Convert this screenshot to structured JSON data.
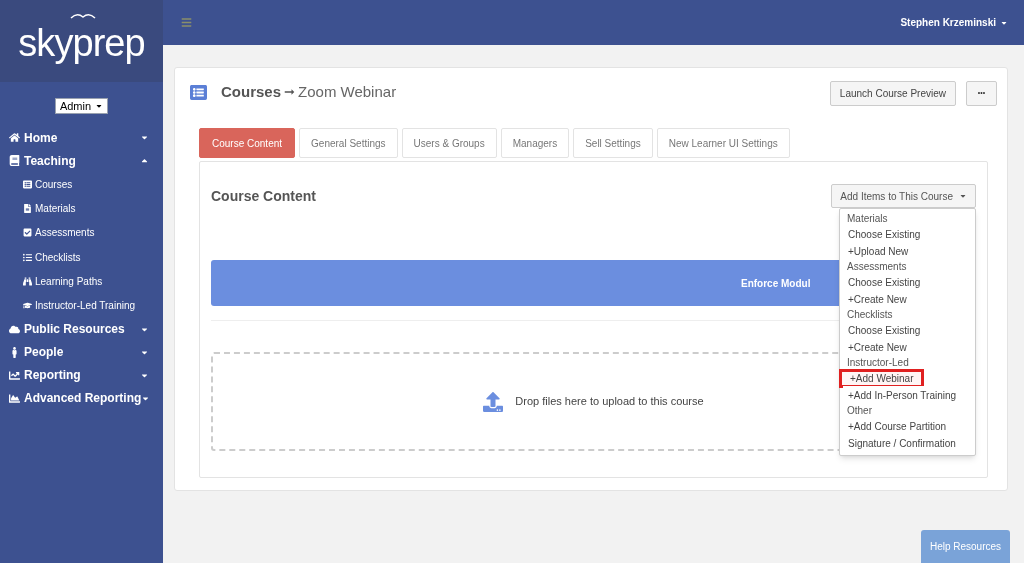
{
  "sidebar": {
    "logo": "skyprep",
    "role_select": "Admin",
    "items": [
      {
        "label": "Home",
        "expanded": false
      },
      {
        "label": "Teaching",
        "expanded": true,
        "children": [
          {
            "label": "Courses"
          },
          {
            "label": "Materials"
          },
          {
            "label": "Assessments"
          },
          {
            "label": "Checklists"
          },
          {
            "label": "Learning Paths"
          },
          {
            "label": "Instructor-Led Training"
          }
        ]
      },
      {
        "label": "Public Resources",
        "expanded": false
      },
      {
        "label": "People",
        "expanded": false
      },
      {
        "label": "Reporting",
        "expanded": false
      },
      {
        "label": "Advanced Reporting",
        "expanded": false
      }
    ]
  },
  "topbar": {
    "user": "Stephen Krzeminski"
  },
  "page": {
    "breadcrumb": "Courses",
    "arrow": "➞",
    "title": "Zoom Webinar",
    "preview_button": "Launch Course Preview",
    "more_button": "•••"
  },
  "tabs": [
    {
      "label": "Course Content",
      "selected": true
    },
    {
      "label": "General Settings",
      "selected": false
    },
    {
      "label": "Users & Groups",
      "selected": false
    },
    {
      "label": "Managers",
      "selected": false
    },
    {
      "label": "Sell Settings",
      "selected": false
    },
    {
      "label": "New Learner UI Settings",
      "selected": false
    }
  ],
  "content": {
    "heading": "Course Content",
    "add_button": "Add Items to This Course",
    "banner": "Enforce Modul",
    "dropzone": "Drop files here to upload to this course"
  },
  "dropdown": [
    {
      "kind": "header",
      "label": "Materials"
    },
    {
      "kind": "item",
      "label": "Choose Existing",
      "highlighted": false
    },
    {
      "kind": "item",
      "label": "+Upload New",
      "highlighted": false
    },
    {
      "kind": "header",
      "label": "Assessments"
    },
    {
      "kind": "item",
      "label": "Choose Existing",
      "highlighted": false
    },
    {
      "kind": "item",
      "label": "+Create New",
      "highlighted": false
    },
    {
      "kind": "header",
      "label": "Checklists"
    },
    {
      "kind": "item",
      "label": "Choose Existing",
      "highlighted": false
    },
    {
      "kind": "item",
      "label": "+Create New",
      "highlighted": false
    },
    {
      "kind": "header",
      "label": "Instructor-Led"
    },
    {
      "kind": "item",
      "label": "+Add Webinar",
      "highlighted": true
    },
    {
      "kind": "item",
      "label": "+Add In-Person Training",
      "highlighted": false
    },
    {
      "kind": "header",
      "label": "Other"
    },
    {
      "kind": "item",
      "label": "+Add Course Partition",
      "highlighted": false
    },
    {
      "kind": "item",
      "label": "Signature / Confirmation",
      "highlighted": false
    }
  ],
  "help_button": "Help Resources"
}
